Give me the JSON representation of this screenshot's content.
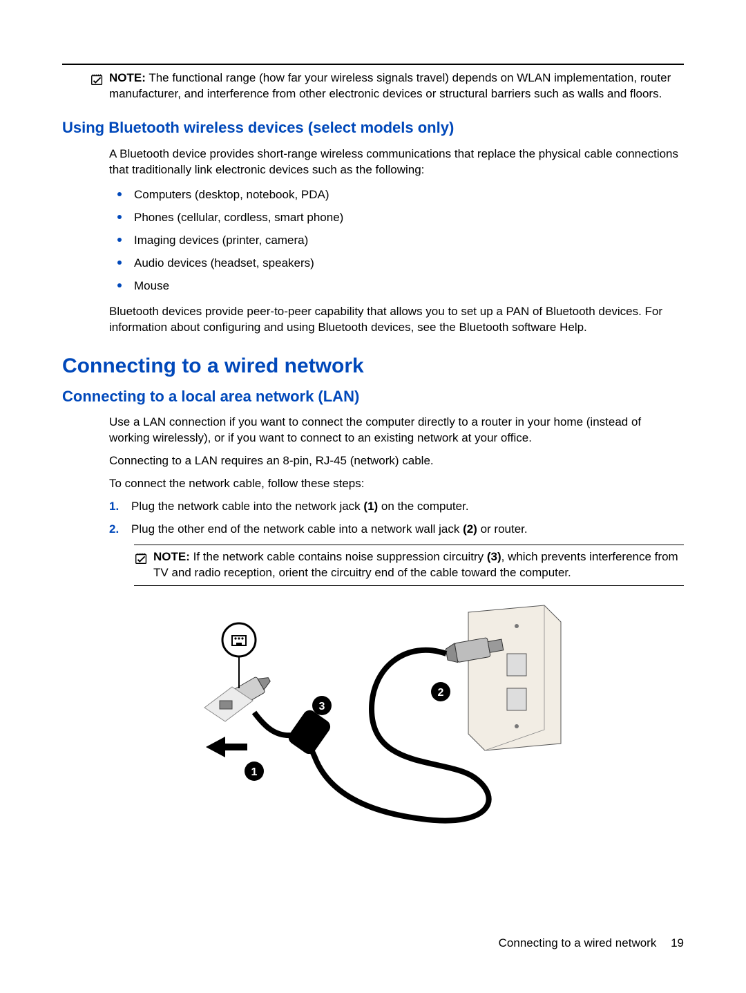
{
  "note1": {
    "label": "NOTE:",
    "text": "The functional range (how far your wireless signals travel) depends on WLAN implementation, router manufacturer, and interference from other electronic devices or structural barriers such as walls and floors."
  },
  "bluetooth": {
    "heading": "Using Bluetooth wireless devices (select models only)",
    "intro": "A Bluetooth device provides short-range wireless communications that replace the physical cable connections that traditionally link electronic devices such as the following:",
    "bullets": [
      "Computers (desktop, notebook, PDA)",
      "Phones (cellular, cordless, smart phone)",
      "Imaging devices (printer, camera)",
      "Audio devices (headset, speakers)",
      "Mouse"
    ],
    "outro": "Bluetooth devices provide peer-to-peer capability that allows you to set up a PAN of Bluetooth devices. For information about configuring and using Bluetooth devices, see the Bluetooth software Help."
  },
  "wired": {
    "heading": "Connecting to a wired network"
  },
  "lan": {
    "heading": "Connecting to a local area network (LAN)",
    "p1": "Use a LAN connection if you want to connect the computer directly to a router in your home (instead of working wirelessly), or if you want to connect to an existing network at your office.",
    "p2": "Connecting to a LAN requires an 8-pin, RJ-45 (network) cable.",
    "p3": "To connect the network cable, follow these steps:",
    "steps": [
      {
        "num": "1.",
        "before": "Plug the network cable into the network jack ",
        "bold": "(1)",
        "after": " on the computer."
      },
      {
        "num": "2.",
        "before": "Plug the other end of the network cable into a network wall jack ",
        "bold": "(2)",
        "after": " or router."
      }
    ],
    "note": {
      "label": "NOTE:",
      "before": "If the network cable contains noise suppression circuitry ",
      "bold": "(3)",
      "after": ", which prevents interference from TV and radio reception, orient the circuitry end of the cable toward the computer."
    }
  },
  "footer": {
    "title": "Connecting to a wired network",
    "page": "19"
  },
  "callouts": {
    "c1": "1",
    "c2": "2",
    "c3": "3"
  }
}
